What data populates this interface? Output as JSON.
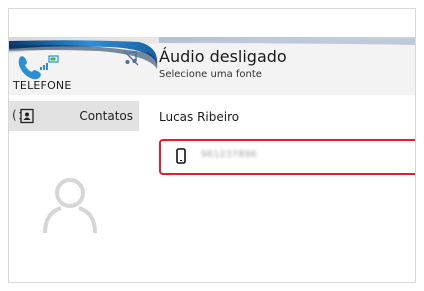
{
  "header": {
    "source_label": "TELEFONE",
    "audio_title": "Áudio desligado",
    "audio_subtitle": "Selecione uma fonte",
    "icons": [
      "phone-handset-icon",
      "signal-icon",
      "battery-icon",
      "music-off-icon"
    ]
  },
  "left_pane": {
    "tab_paren": "(",
    "contacts_label": "Contatos",
    "icons": [
      "contacts-icon",
      "avatar-icon"
    ]
  },
  "contact": {
    "name": "Lucas Ribeiro",
    "phone_number": "961237896",
    "phone_type_icon": "mobile-phone-icon"
  },
  "colors": {
    "accent_blue": "#2b8fd8",
    "highlight_border": "#e0202a",
    "tab_bg": "#e2e2e2"
  }
}
